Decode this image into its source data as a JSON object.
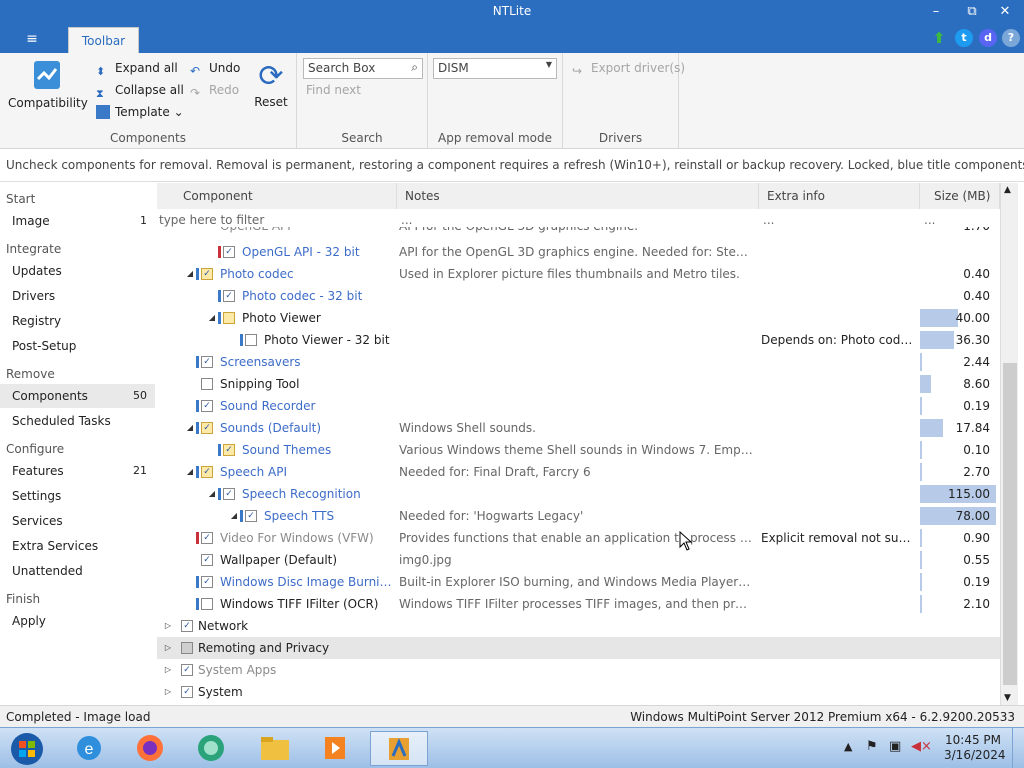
{
  "window": {
    "title": "NTLite"
  },
  "titlebar": {
    "menu_glyph": "≡",
    "minimize": "–",
    "maximize": "⧉",
    "close": "✕",
    "help": "?"
  },
  "ribbon": {
    "tab": "Toolbar",
    "compatibility": "Compatibility",
    "expand_all": "Expand all",
    "collapse_all": "Collapse all",
    "template": "Template",
    "undo": "Undo",
    "redo": "Redo",
    "reset": "Reset",
    "group_components": "Components",
    "search_placeholder": "Search Box",
    "find_next": "Find next",
    "group_search": "Search",
    "removal_mode": "DISM",
    "group_removal": "App removal mode",
    "export_drivers": "Export driver(s)",
    "group_drivers": "Drivers"
  },
  "infobar": "Uncheck components for removal. Removal is permanent, restoring a component requires a refresh (Win10+), reinstall or backup recovery. Locked, blue title components require a license.",
  "sidebar": {
    "start": "Start",
    "image": {
      "label": "Image",
      "count": "1"
    },
    "integrate": "Integrate",
    "updates": "Updates",
    "drivers": "Drivers",
    "registry": "Registry",
    "post_setup": "Post-Setup",
    "remove": "Remove",
    "components": {
      "label": "Components",
      "count": "50"
    },
    "scheduled_tasks": "Scheduled Tasks",
    "configure": "Configure",
    "features": {
      "label": "Features",
      "count": "21"
    },
    "settings": "Settings",
    "services": "Services",
    "extra_services": "Extra Services",
    "unattended": "Unattended",
    "finish": "Finish",
    "apply": "Apply"
  },
  "tree": {
    "columns": {
      "component": "Component",
      "notes": "Notes",
      "extra": "Extra info",
      "size": "Size (MB)"
    },
    "filter": {
      "component": "type here to filter",
      "notes": "...",
      "extra": "...",
      "size": "..."
    },
    "partial": {
      "name": "OpenGL API",
      "notes": "API for the OpenGL 3D graphics engine.",
      "size": "1.70"
    },
    "rows": [
      {
        "name": "OpenGL API - 32 bit",
        "notes": "API for the OpenGL 3D graphics engine. Needed for: Steam, Path ...",
        "extra": "",
        "size": ""
      },
      {
        "name": "Photo codec",
        "notes": "Used in Explorer picture files thumbnails and Metro tiles.",
        "extra": "",
        "size": "0.40"
      },
      {
        "name": "Photo codec - 32 bit",
        "notes": "",
        "extra": "",
        "size": "0.40"
      },
      {
        "name": "Photo Viewer",
        "notes": "",
        "extra": "",
        "size": "40.00"
      },
      {
        "name": "Photo Viewer - 32 bit",
        "notes": "",
        "extra": "Depends on: Photo codec -...",
        "size": "36.30"
      },
      {
        "name": "Screensavers",
        "notes": "",
        "extra": "",
        "size": "2.44"
      },
      {
        "name": "Snipping Tool",
        "notes": "",
        "extra": "",
        "size": "8.60"
      },
      {
        "name": "Sound Recorder",
        "notes": "",
        "extra": "",
        "size": "0.19"
      },
      {
        "name": "Sounds (Default)",
        "notes": "Windows Shell sounds.",
        "extra": "",
        "size": "17.84"
      },
      {
        "name": "Sound Themes",
        "notes": "Various Windows theme Shell sounds in Windows 7. Empty packa...",
        "extra": "",
        "size": "0.10"
      },
      {
        "name": "Speech API",
        "notes": "Needed for: Final Draft, Farcry 6",
        "extra": "",
        "size": "2.70"
      },
      {
        "name": "Speech Recognition",
        "notes": "",
        "extra": "",
        "size": "115.00"
      },
      {
        "name": "Speech TTS",
        "notes": "Needed for: 'Hogwarts Legacy'",
        "extra": "",
        "size": "78.00"
      },
      {
        "name": "Video For Windows (VFW)",
        "notes": "Provides functions that enable an application to process video da...",
        "extra": "Explicit removal not suppor...",
        "size": "0.90"
      },
      {
        "name": "Wallpaper (Default)",
        "notes": "img0.jpg",
        "extra": "",
        "size": "0.55"
      },
      {
        "name": "Windows Disc Image Burning T...",
        "notes": "Built-in Explorer ISO burning, and Windows Media Player rip/burn...",
        "extra": "",
        "size": "0.19"
      },
      {
        "name": "Windows TIFF IFilter (OCR)",
        "notes": "Windows TIFF IFilter processes TIFF images, and then provides th...",
        "extra": "",
        "size": "2.10"
      },
      {
        "name": "Network",
        "notes": "",
        "extra": "",
        "size": ""
      },
      {
        "name": "Remoting and Privacy",
        "notes": "",
        "extra": "",
        "size": ""
      },
      {
        "name": "System Apps",
        "notes": "",
        "extra": "",
        "size": ""
      },
      {
        "name": "System",
        "notes": "",
        "extra": "",
        "size": ""
      }
    ],
    "size_fill": {
      "0.40": 0,
      "40.00": 0.5,
      "36.30": 0.45,
      "8.60": 0.14,
      "17.84": 0.3,
      "115.00": 1.0,
      "78.00": 1.0
    }
  },
  "status": {
    "left": "Completed - Image load",
    "right": "Windows MultiPoint Server 2012 Premium x64 - 6.2.9200.20533"
  },
  "taskbar": {
    "time": "10:45 PM",
    "date": "3/16/2024"
  },
  "colors": {
    "title": "#2b6dbf",
    "link_blue": "#3c6cc8",
    "size_bar": "#b7cbe8"
  }
}
